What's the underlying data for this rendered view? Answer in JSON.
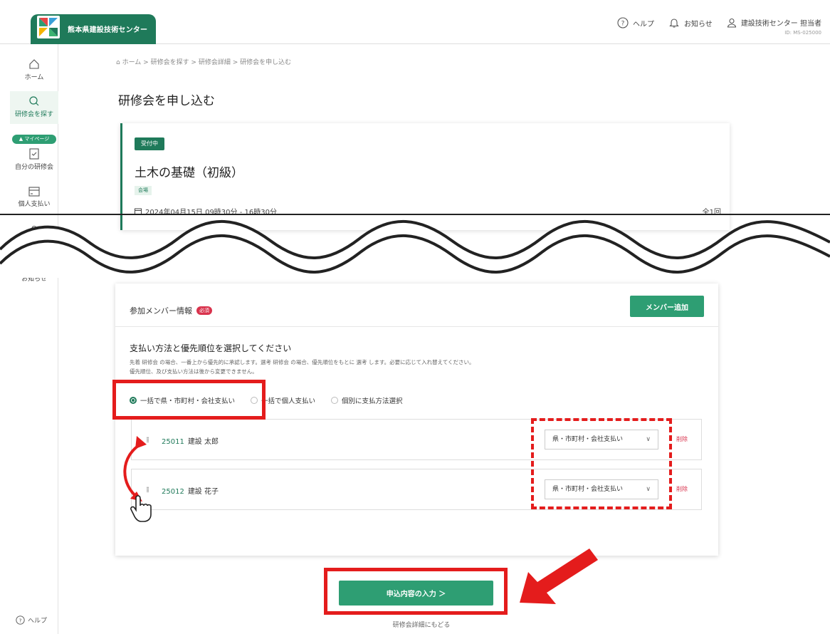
{
  "header": {
    "brand": "熊本県建設技術センター",
    "help": "ヘルプ",
    "notifications": "お知らせ",
    "user_name": "建設技術センター 担当者",
    "user_id": "ID: MS-025000"
  },
  "sidebar": {
    "home": "ホーム",
    "search": "研修会を探す",
    "mypage": "▲ マイページ",
    "my_courses": "自分の研修会",
    "personal_payment": "個人支払い",
    "notifications": "お知らせ",
    "help": "ヘルプ"
  },
  "breadcrumb": "ホーム > 研修会を探す > 研修会詳細 > 研修会を申し込む",
  "page_title": "研修会を申し込む",
  "course": {
    "status": "受付中",
    "title": "土木の基礎（初級）",
    "venue": "会場",
    "date": "2024年04月15日 09時30分 - 16時30分",
    "count": "全1回"
  },
  "members": {
    "title": "参加メンバー情報",
    "required": "必須",
    "add_button": "メンバー追加",
    "pay_heading": "支払い方法と優先順位を選択してください",
    "pay_desc_1": "先着 研修会 の場合、一番上から優先的に承認します。選考 研修会 の場合、優先順位をもとに 選考 します。必要に応じて入れ替えてください。",
    "pay_desc_2": "優先順位、及び支払い方法は後から変更できません。",
    "radio_options": [
      "一括で県・市町村・会社支払い",
      "一括で個人支払い",
      "個別に支払方法選択"
    ],
    "rows": [
      {
        "id": "25011",
        "name": "建設 太郎",
        "payment": "県・市町村・会社支払い",
        "delete": "削除"
      },
      {
        "id": "25012",
        "name": "建設 花子",
        "payment": "県・市町村・会社支払い",
        "delete": "削除"
      }
    ]
  },
  "actions": {
    "submit": "申込内容の入力 ＞",
    "back": "研修会詳細にもどる"
  },
  "colors": {
    "brand_green": "#1f7a5a",
    "button_green": "#2e9e73",
    "annotation_red": "#e41c1c",
    "danger": "#d9334d"
  }
}
